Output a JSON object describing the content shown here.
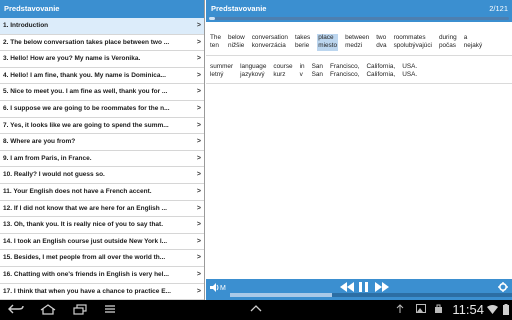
{
  "left": {
    "title": "Predstavovanie",
    "items": [
      {
        "label": "1. Introduction"
      },
      {
        "label": "2. The below conversation takes place between two ..."
      },
      {
        "label": "3. Hello! How are you? My name is Veronika."
      },
      {
        "label": "4. Hello! I am fine, thank you. My name is Dominica..."
      },
      {
        "label": "5. Nice to meet you. I am fine as well, thank you for ..."
      },
      {
        "label": "6. I suppose we are going to be roommates for the n..."
      },
      {
        "label": "7. Yes, it looks like we are going to spend the summ..."
      },
      {
        "label": "8. Where are you from?"
      },
      {
        "label": "9. I am from Paris, in France."
      },
      {
        "label": "10. Really? I would not guess so."
      },
      {
        "label": "11. Your English does not have a French accent."
      },
      {
        "label": "12. If I did not know that we are here for an English ..."
      },
      {
        "label": "13. Oh, thank you. It is really nice of you to say that."
      },
      {
        "label": "14. I took an English course just outside New York l..."
      },
      {
        "label": "15. Besides, I met people from all over the world th..."
      },
      {
        "label": "16. Chatting with one's friends in English is very hel..."
      },
      {
        "label": "17. I think that when you have a chance to practice E..."
      }
    ],
    "chevron": ">"
  },
  "right": {
    "title": "Predstavovanie",
    "counter": "2/121",
    "progress_fraction": 0.02,
    "sentence1": [
      {
        "en": "The",
        "sk": "ten"
      },
      {
        "en": "below",
        "sk": "nižšie"
      },
      {
        "en": "conversation",
        "sk": "konverzácia"
      },
      {
        "en": "takes",
        "sk": "berie"
      },
      {
        "en": "place",
        "sk": "miesto"
      },
      {
        "en": "between",
        "sk": "medzi"
      },
      {
        "en": "two",
        "sk": "dva"
      },
      {
        "en": "roommates",
        "sk": "spolubývajúci"
      },
      {
        "en": "during",
        "sk": "počas"
      },
      {
        "en": "a",
        "sk": "nejaký"
      }
    ],
    "sentence2": [
      {
        "en": "summer",
        "sk": "letný"
      },
      {
        "en": "language",
        "sk": "jazykový"
      },
      {
        "en": "course",
        "sk": "kurz"
      },
      {
        "en": "in",
        "sk": "v"
      },
      {
        "en": "San",
        "sk": "San"
      },
      {
        "en": "Francisco,",
        "sk": "Francisco,"
      },
      {
        "en": "California,",
        "sk": "California,"
      },
      {
        "en": "USA.",
        "sk": "USA."
      }
    ]
  },
  "player": {
    "speed_label": "M",
    "progress_fraction": 0.36
  },
  "status": {
    "time": "11:54"
  },
  "icons": {
    "back": "back-arrow-icon",
    "home": "home-icon",
    "recent": "recent-apps-icon",
    "menu": "menu-icon",
    "up": "chevron-up-icon",
    "volume": "volume-icon",
    "rewind": "rewind-icon",
    "pause": "pause-icon",
    "forward": "fast-forward-icon",
    "settings": "gear-icon"
  },
  "colors": {
    "accent": "#3b8fd0",
    "highlight": "#bcd6ef"
  }
}
